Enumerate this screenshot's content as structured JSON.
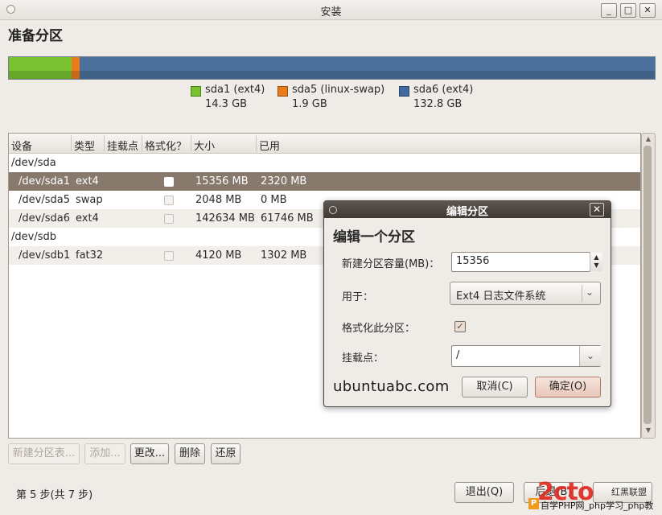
{
  "window": {
    "title": "安装",
    "minimize": "_",
    "maximize": "□",
    "close": "✕"
  },
  "page_title": "准备分区",
  "disk_bar": {
    "segments": [
      {
        "name": "sda1",
        "color": "#7ac231",
        "fraction": 0.0972
      },
      {
        "name": "sda5",
        "color": "#ea7b1b",
        "fraction": 0.0129
      },
      {
        "name": "sda6",
        "color": "#4a6f9a",
        "fraction": 0.8999
      }
    ]
  },
  "legend": [
    {
      "label": "sda1 (ext4)",
      "size": "14.3 GB",
      "color": "#7ac231"
    },
    {
      "label": "sda5 (linux-swap)",
      "size": "1.9 GB",
      "color": "#ea7b1b"
    },
    {
      "label": "sda6 (ext4)",
      "size": "132.8 GB",
      "color": "#3f6aa0"
    }
  ],
  "table": {
    "headers": [
      "设备",
      "类型",
      "挂载点",
      "格式化？",
      "大小",
      "已用"
    ],
    "rows": [
      {
        "device": "/dev/sda",
        "type": "",
        "mount": "",
        "size": "",
        "used": ""
      },
      {
        "device": "/dev/sda1",
        "type": "ext4",
        "mount": "",
        "format": true,
        "size": "15356 MB",
        "used": "2320 MB"
      },
      {
        "device": "/dev/sda5",
        "type": "swap",
        "mount": "",
        "format": false,
        "size": "2048 MB",
        "used": "0 MB"
      },
      {
        "device": "/dev/sda6",
        "type": "ext4",
        "mount": "",
        "format": false,
        "size": "142634 MB",
        "used": "61746 MB"
      },
      {
        "device": "/dev/sdb",
        "type": "",
        "mount": "",
        "size": "",
        "used": ""
      },
      {
        "device": "/dev/sdb1",
        "type": "fat32",
        "mount": "",
        "format": false,
        "size": "4120 MB",
        "used": "1302 MB"
      }
    ]
  },
  "buttons": {
    "new_table": "新建分区表...",
    "add": "添加...",
    "change": "更改...",
    "delete": "删除",
    "revert": "还原",
    "quit": "退出(Q)",
    "back": "后退(B)"
  },
  "step_text": "第 5 步(共 7 步)",
  "dialog": {
    "title": "编辑分区",
    "close": "✕",
    "heading": "编辑一个分区",
    "size_label": "新建分区容量(MB)：",
    "size_value": "15356",
    "use_label": "用于：",
    "use_value": "Ext4 日志文件系统",
    "format_label": "格式化此分区：",
    "format_checked": true,
    "mount_label": "挂载点：",
    "mount_value": "/",
    "website": "ubuntuabc.com",
    "cancel": "取消(C)",
    "ok": "确定(O)"
  },
  "watermark": {
    "text": "自学PHP网_php学习_php教",
    "logo": "P",
    "brand": "2cto",
    "tag": "红黑联盟"
  }
}
